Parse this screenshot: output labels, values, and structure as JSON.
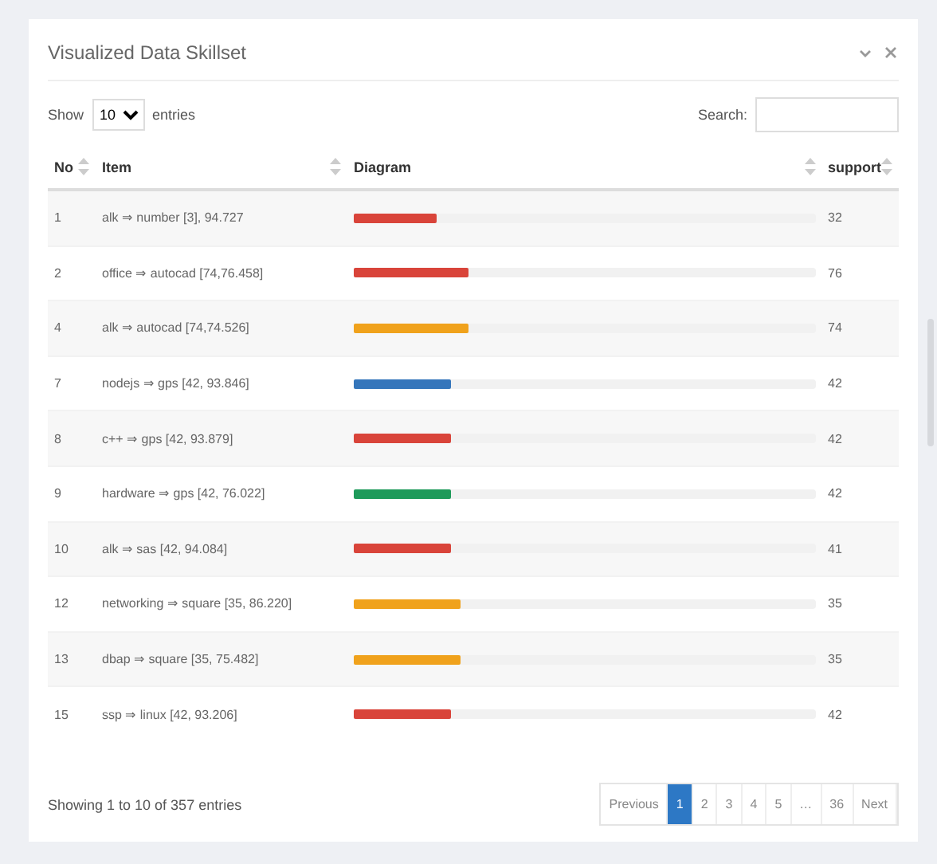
{
  "panel": {
    "title": "Visualized Data Skillset"
  },
  "length_control": {
    "label_before": "Show",
    "value": "10",
    "label_after": "entries"
  },
  "search": {
    "label": "Search:"
  },
  "table": {
    "columns": [
      "No",
      "Item",
      "Diagram",
      "support"
    ],
    "rows": [
      {
        "no": "1",
        "item": "alk ⇒ number [3], 94.727",
        "level": 0.18,
        "color": "#d9443a",
        "support": "32"
      },
      {
        "no": "2",
        "item": "office ⇒ autocad [74,76.458]",
        "level": 0.25,
        "color": "#d9443a",
        "support": "76"
      },
      {
        "no": "4",
        "item": "alk ⇒ autocad [74,74.526]",
        "level": 0.25,
        "color": "#f0a21c",
        "support": "74"
      },
      {
        "no": "7",
        "item": "nodejs ⇒ gps [42, 93.846]",
        "level": 0.21,
        "color": "#3576bb",
        "support": "42"
      },
      {
        "no": "8",
        "item": "c++ ⇒ gps [42, 93.879]",
        "level": 0.21,
        "color": "#d9443a",
        "support": "42"
      },
      {
        "no": "9",
        "item": "hardware ⇒ gps [42, 76.022]",
        "level": 0.21,
        "color": "#1e9a5a",
        "support": "42"
      },
      {
        "no": "10",
        "item": "alk ⇒ sas [42, 94.084]",
        "level": 0.21,
        "color": "#d9443a",
        "support": "41"
      },
      {
        "no": "12",
        "item": "networking ⇒ square [35, 86.220]",
        "level": 0.23,
        "color": "#f0a21c",
        "support": "35"
      },
      {
        "no": "13",
        "item": "dbap ⇒ square [35, 75.482]",
        "level": 0.23,
        "color": "#f0a21c",
        "support": "35"
      },
      {
        "no": "15",
        "item": "ssp ⇒ linux [42, 93.206]",
        "level": 0.21,
        "color": "#d9443a",
        "support": "42"
      }
    ]
  },
  "info": "Showing 1 to 10 of 357 entries",
  "pagination": [
    {
      "label": "Previous",
      "selected": false
    },
    {
      "label": "1",
      "selected": true
    },
    {
      "label": "2",
      "selected": false
    },
    {
      "label": "3",
      "selected": false
    },
    {
      "label": "4",
      "selected": false
    },
    {
      "label": "5",
      "selected": false
    },
    {
      "label": "…",
      "selected": false
    },
    {
      "label": "36",
      "selected": false
    },
    {
      "label": "Next",
      "selected": false
    }
  ]
}
